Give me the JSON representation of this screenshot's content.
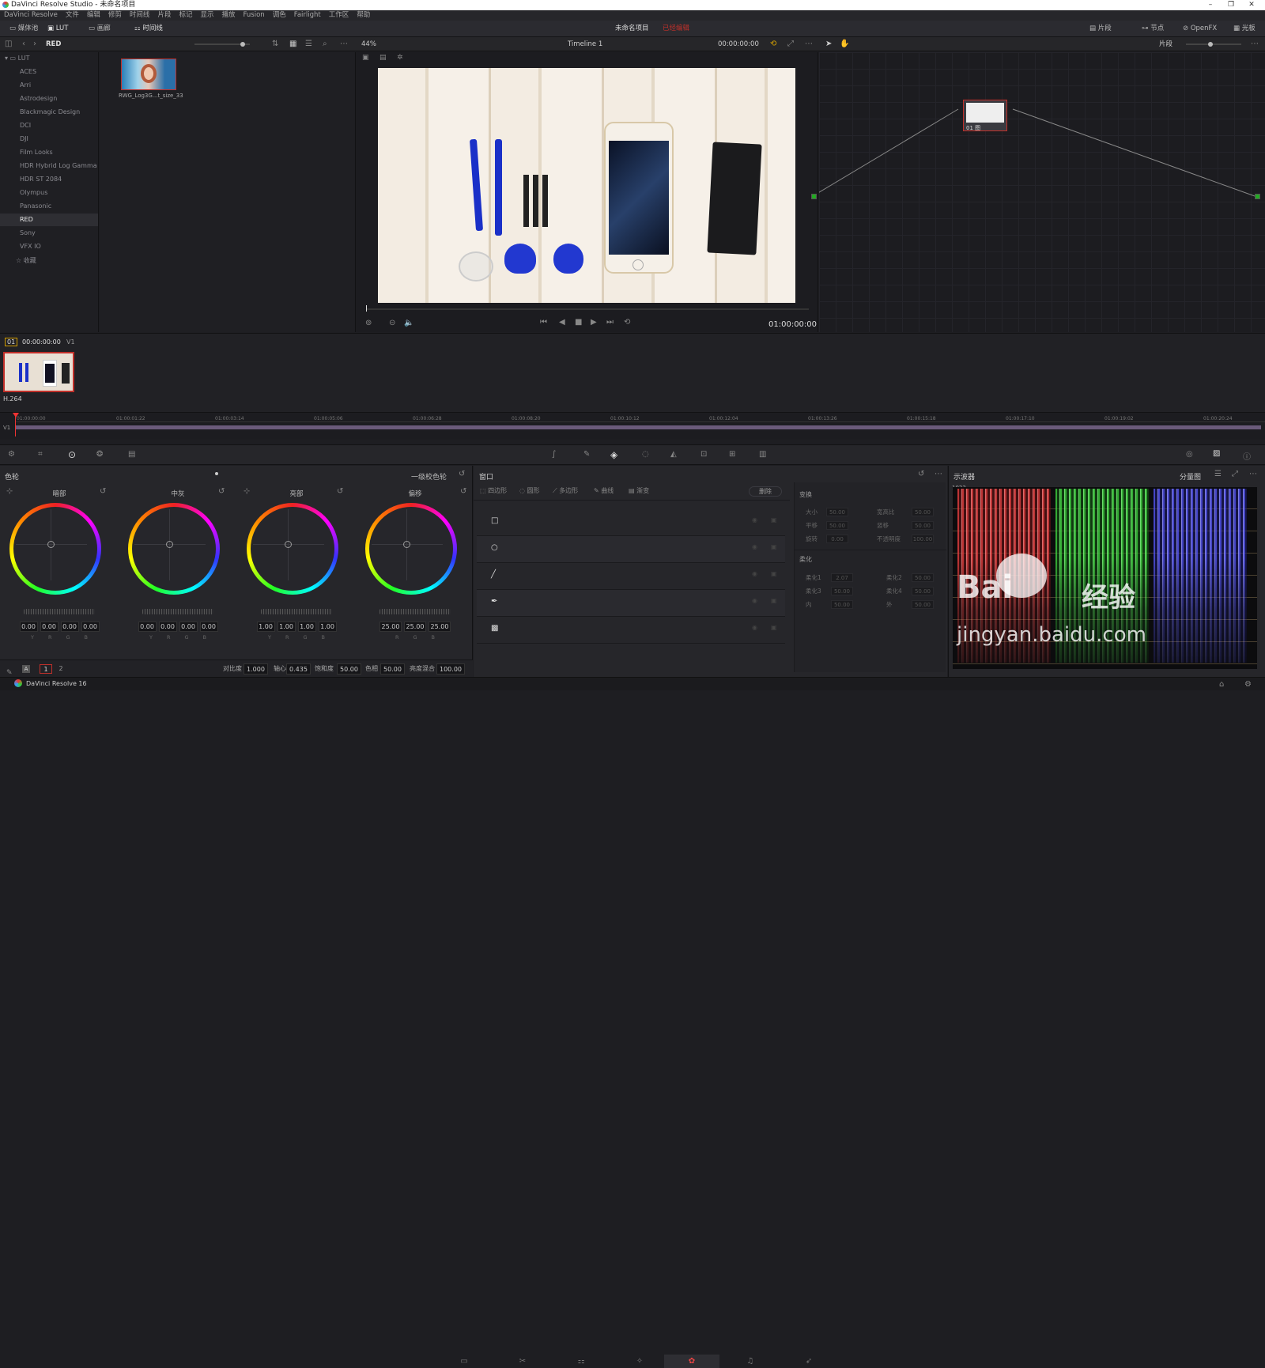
{
  "window": {
    "title": "DaVinci Resolve Studio - 未命名项目",
    "minimize": "–",
    "maximize": "❐",
    "close": "✕"
  },
  "menu": [
    "DaVinci Resolve",
    "文件",
    "编辑",
    "修剪",
    "时间线",
    "片段",
    "标记",
    "显示",
    "播放",
    "Fusion",
    "调色",
    "Fairlight",
    "工作区",
    "帮助"
  ],
  "toolbar": {
    "media_pool": "媒体池",
    "lut": "LUT",
    "gallery": "画廊",
    "timeline": "时间线",
    "project_name": "未命名项目",
    "project_status": "已经编辑",
    "clips": "片段",
    "nodes": "节点",
    "openfx": "OpenFX",
    "library": "光板"
  },
  "toolbar2": {
    "lut_folder": "RED",
    "zoom": "44%",
    "timeline_name": "Timeline 1",
    "timecode": "00:00:00:00",
    "node_mode": "片段"
  },
  "lut_tree": {
    "root": "LUT",
    "items": [
      "ACES",
      "Arri",
      "Astrodesign",
      "Blackmagic Design",
      "DCI",
      "DJI",
      "Film Looks",
      "HDR Hybrid Log Gamma",
      "HDR ST 2084",
      "Olympus",
      "Panasonic",
      "RED",
      "Sony",
      "VFX IO"
    ],
    "selected": "RED",
    "favorites": "收藏"
  },
  "lut_thumb": {
    "label": "RWG_Log3G...t_size_33"
  },
  "viewer": {
    "timecode": "01:00:00:00"
  },
  "clip_strip": {
    "index": "01",
    "timecode": "00:00:00:00",
    "track": "V1",
    "codec": "H.264"
  },
  "ruler": {
    "labels": [
      "01:00:00:00",
      "01:00:01:22",
      "01:00:03:14",
      "01:00:05:06",
      "01:00:06:28",
      "01:00:08:20",
      "01:00:10:12",
      "01:00:12:04",
      "01:00:13:26",
      "01:00:15:18",
      "01:00:17:10",
      "01:00:19:02",
      "01:00:20:24"
    ],
    "track": "V1"
  },
  "node": {
    "label": "01 图"
  },
  "color_wheels": {
    "panel_title": "色轮",
    "mode": "一级校色轮",
    "wheels": [
      {
        "label": "暗部",
        "values": [
          "0.00",
          "0.00",
          "0.00",
          "0.00"
        ],
        "subs": [
          "Y",
          "R",
          "G",
          "B"
        ]
      },
      {
        "label": "中灰",
        "values": [
          "0.00",
          "0.00",
          "0.00",
          "0.00"
        ],
        "subs": [
          "Y",
          "R",
          "G",
          "B"
        ]
      },
      {
        "label": "亮部",
        "values": [
          "1.00",
          "1.00",
          "1.00",
          "1.00"
        ],
        "subs": [
          "Y",
          "R",
          "G",
          "B"
        ]
      },
      {
        "label": "偏移",
        "values": [
          "25.00",
          "25.00",
          "25.00"
        ],
        "subs": [
          "R",
          "G",
          "B"
        ]
      }
    ],
    "bottom": {
      "page1": "1",
      "page2": "2",
      "contrast_label": "对比度",
      "contrast": "1.000",
      "pivot_label": "轴心",
      "pivot": "0.435",
      "sat_label": "饱和度",
      "sat": "50.00",
      "hue_label": "色相",
      "hue": "50.00",
      "lummix_label": "亮度混合",
      "lummix": "100.00"
    }
  },
  "window_panel": {
    "title": "窗口",
    "tools": [
      "四边形",
      "圆形",
      "多边形",
      "曲线",
      "渐变"
    ],
    "delete": "删除",
    "transform_title": "变换",
    "transform_rows": [
      {
        "l1": "大小",
        "v1": "50.00",
        "l2": "宽高比",
        "v2": "50.00"
      },
      {
        "l1": "平移",
        "v1": "50.00",
        "l2": "竖移",
        "v2": "50.00"
      },
      {
        "l1": "旋转",
        "v1": "0.00",
        "l2": "不透明度",
        "v2": "100.00"
      }
    ],
    "soft_title": "柔化",
    "soft_rows": [
      {
        "l1": "柔化1",
        "v1": "2.07",
        "l2": "柔化2",
        "v2": "50.00"
      },
      {
        "l1": "柔化3",
        "v1": "50.00",
        "l2": "柔化4",
        "v2": "50.00"
      },
      {
        "l1": "内",
        "v1": "50.00",
        "l2": "外",
        "v2": "50.00"
      }
    ]
  },
  "scope": {
    "title": "示波器",
    "mode": "分量图",
    "scale": [
      "1023",
      "896",
      "768",
      "640",
      "512",
      "384",
      "256",
      "128",
      "0"
    ]
  },
  "watermark": {
    "line1": "Bai",
    "line2": "经验",
    "line3": "jingyan.baidu.com"
  },
  "statusbar": {
    "app": "DaVinci Resolve 16"
  },
  "colors": {
    "accent_red": "#c0302a",
    "bg": "#1e1e22",
    "panel": "#26262a"
  }
}
